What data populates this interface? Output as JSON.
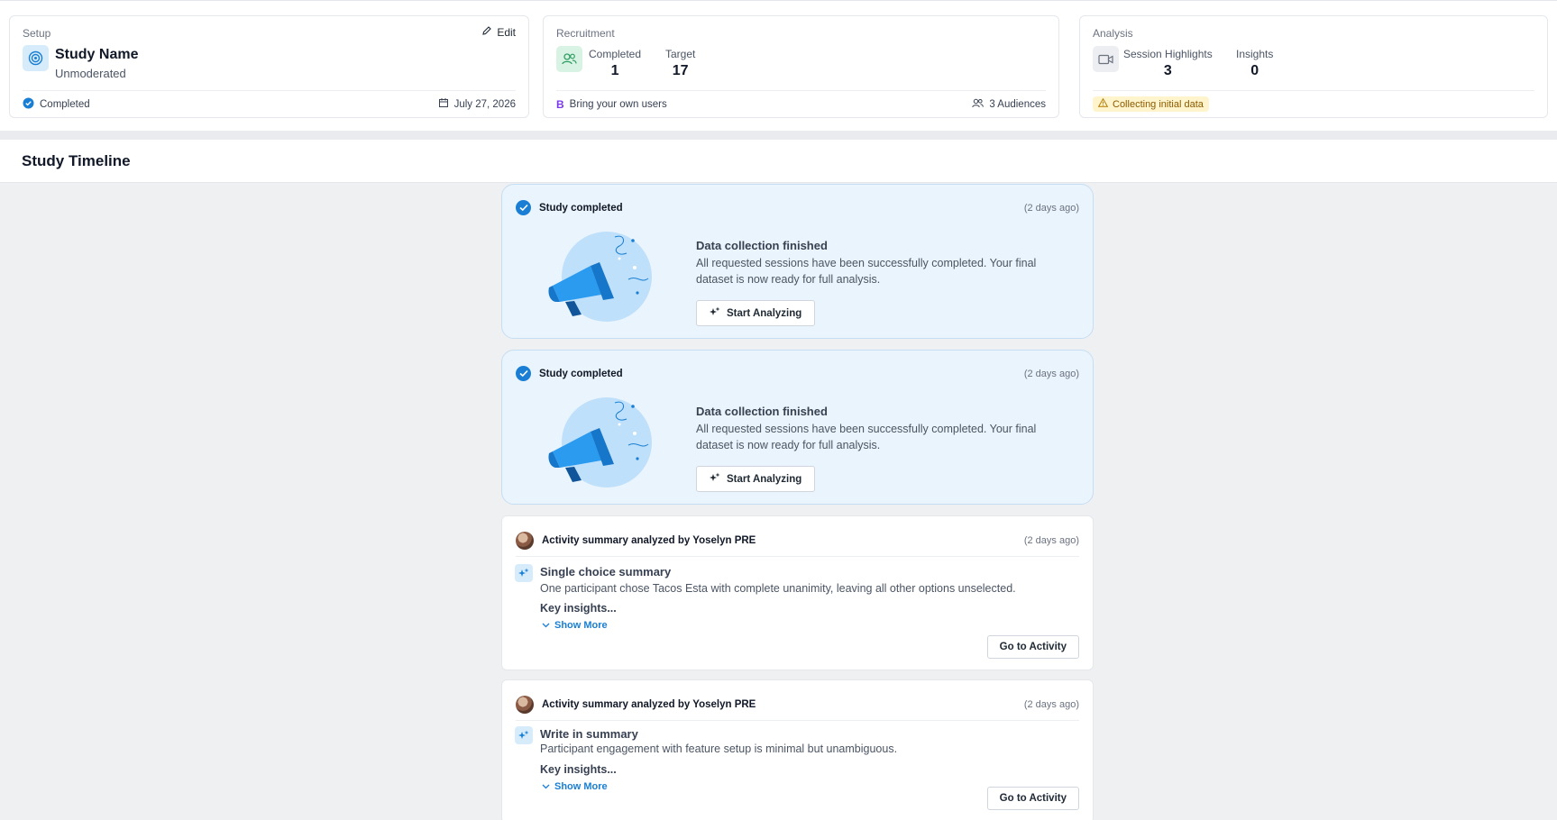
{
  "setup": {
    "label": "Setup",
    "edit_label": "Edit",
    "study_name": "Study Name",
    "study_type": "Unmoderated",
    "status": "Completed",
    "date": "July 27, 2026"
  },
  "recruitment": {
    "label": "Recruitment",
    "completed_label": "Completed",
    "completed_value": "1",
    "target_label": "Target",
    "target_value": "17",
    "source_badge": "B",
    "source_text": "Bring your own users",
    "audiences": "3 Audiences"
  },
  "analysis": {
    "label": "Analysis",
    "highlights_label": "Session Highlights",
    "highlights_value": "3",
    "insights_label": "Insights",
    "insights_value": "0",
    "status_pill": "Collecting initial data"
  },
  "timeline": {
    "title": "Study Timeline",
    "events": [
      {
        "title": "Study completed",
        "time": "(2 days ago)",
        "body_title": "Data collection finished",
        "body_text": "All requested sessions have been successfully completed. Your final dataset is now ready for full analysis.",
        "button": "Start Analyzing"
      },
      {
        "title": "Study completed",
        "time": "(2 days ago)",
        "body_title": "Data collection finished",
        "body_text": "All requested sessions have been successfully completed. Your final dataset is now ready for full analysis.",
        "button": "Start Analyzing"
      },
      {
        "title": "Activity summary analyzed by Yoselyn PRE",
        "time": "(2 days ago)",
        "summary_title": "Single choice summary",
        "summary_text": "One participant chose Tacos Esta with complete unanimity, leaving all other options unselected.",
        "key_insights": "Key insights...",
        "show_more": "Show More",
        "button": "Go to Activity"
      },
      {
        "title": "Activity summary analyzed by Yoselyn PRE",
        "time": "(2 days ago)",
        "summary_title": "Write in summary",
        "summary_text": "Participant engagement with feature setup is minimal but unambiguous.",
        "key_insights": "Key insights...",
        "show_more": "Show More",
        "button": "Go to Activity"
      }
    ]
  },
  "colors": {
    "accent": "#1a7fd4",
    "completed_card_bg": "#eaf4fc",
    "warning_bg": "#fff4cc",
    "warning_text": "#8a5a00",
    "badge_purple": "#7c3aed"
  }
}
